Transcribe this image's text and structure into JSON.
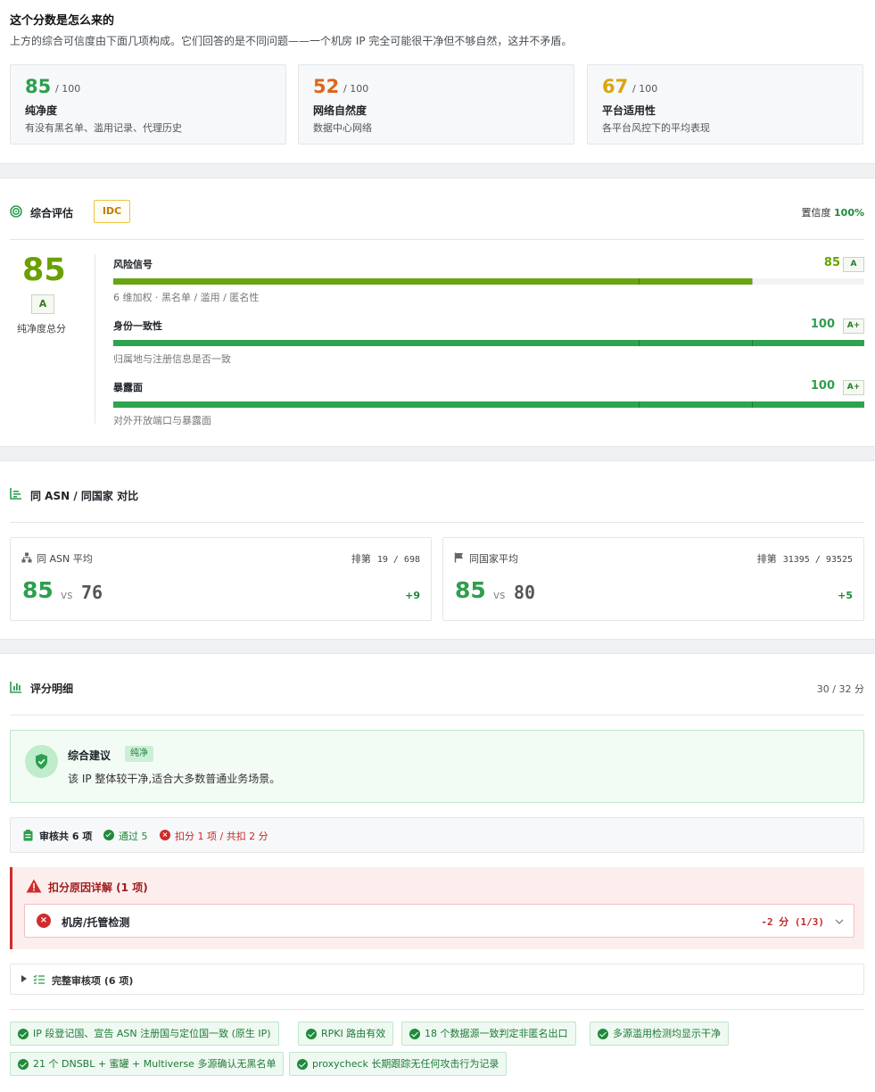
{
  "intro": {
    "title": "这个分数是怎么来的",
    "subtitle": "上方的综合可信度由下面几项构成。它们回答的是不同问题——一个机房 IP 完全可能很干净但不够自然，这并不矛盾。",
    "cards": [
      {
        "score": "85",
        "denominator": "/ 100",
        "name": "纯净度",
        "desc": "有没有黑名单、滥用记录、代理历史",
        "color": "#2e9e4f"
      },
      {
        "score": "52",
        "denominator": "/ 100",
        "name": "网络自然度",
        "desc": "数据中心网络",
        "color": "#e0651b"
      },
      {
        "score": "67",
        "denominator": "/ 100",
        "name": "平台适用性",
        "desc": "各平台风控下的平均表现",
        "color": "#d9a50f"
      }
    ]
  },
  "overall": {
    "title": "综合评估",
    "badge": "IDC",
    "confidence_label": "置信度",
    "confidence_value": "100%",
    "score": "85",
    "grade": "A",
    "score_label": "纯净度总分",
    "metrics": [
      {
        "name": "风险信号",
        "value": "85",
        "grade": "A",
        "desc": "6 维加权 · 黑名单 / 滥用 / 匿名性",
        "fill": 0.85,
        "color": "#68a513",
        "value_color": "#6aa000"
      },
      {
        "name": "身份一致性",
        "value": "100",
        "grade": "A+",
        "desc": "归属地与注册信息是否一致",
        "fill": 1.0,
        "color": "#2ea44f",
        "value_color": "#2e9e4f"
      },
      {
        "name": "暴露面",
        "value": "100",
        "grade": "A+",
        "desc": "对外开放端口与暴露面",
        "fill": 1.0,
        "color": "#2ea44f",
        "value_color": "#2e9e4f"
      }
    ]
  },
  "compare": {
    "title": "同 ASN / 同国家 对比",
    "cards": [
      {
        "label": "同 ASN 平均",
        "rank_label": "排第",
        "rank": "19 / 698",
        "score": "85",
        "vs": "vs",
        "avg": "76",
        "diff": "+9"
      },
      {
        "label": "同国家平均",
        "rank_label": "排第",
        "rank": "31395 / 93525",
        "score": "85",
        "vs": "vs",
        "avg": "80",
        "diff": "+5"
      }
    ]
  },
  "detail": {
    "title": "评分明细",
    "points": "30 / 32 分",
    "advice": {
      "title": "综合建议",
      "tag": "纯净",
      "text": "该 IP 整体较干净,适合大多数普通业务场景。"
    },
    "audit": {
      "total": "审核共 6 项",
      "passed": "通过 5",
      "deducted": "扣分 1 项 / 共扣 2 分"
    },
    "deduction": {
      "title": "扣分原因详解 (1 项)",
      "item": "机房/托管检测",
      "score": "-2 分 (1/3)"
    },
    "full_audit": "完整审核项 (6 项)",
    "pills": [
      "IP 段登记国、宣告 ASN 注册国与定位国一致 (原生 IP)",
      "RPKI 路由有效",
      "18 个数据源一致判定非匿名出口",
      "多源滥用检测均显示干净",
      "21 个 DNSBL + 蜜罐 + Multiverse 多源确认无黑名单",
      "proxycheck 长期跟踪无任何攻击行为记录"
    ]
  }
}
